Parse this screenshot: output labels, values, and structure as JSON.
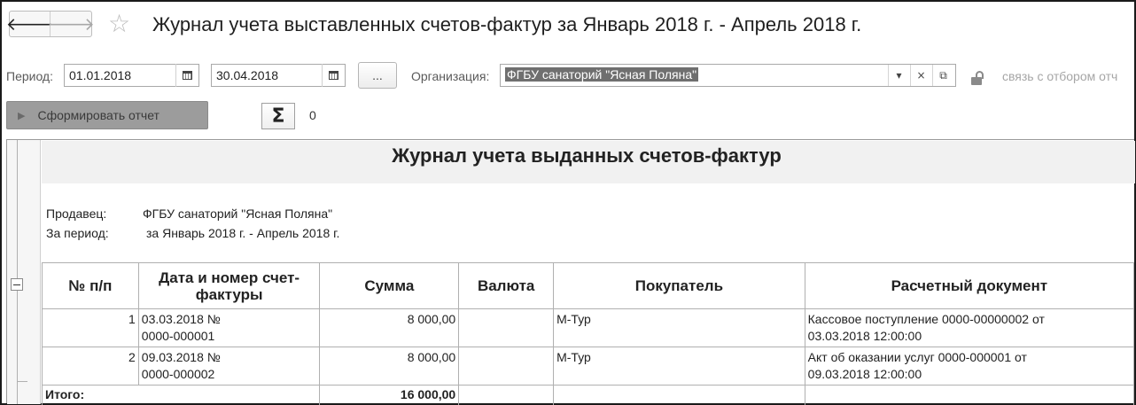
{
  "window": {
    "title": "Журнал учета выставленных счетов-фактур за Январь 2018 г. - Апрель 2018 г.",
    "back_icon": "arrow-left",
    "forward_icon": "arrow-right",
    "favorite_icon": "star"
  },
  "filters": {
    "period_label": "Период:",
    "period_from": "01.01.2018",
    "period_to": "30.04.2018",
    "ellipsis_label": "...",
    "org_label": "Организация:",
    "org_value": "ФГБУ санаторий \"Ясная Поляна\"",
    "org_dropdown": "▾",
    "org_clear": "×",
    "org_open": "⧉",
    "link_label": "связь с отбором отч"
  },
  "actions": {
    "generate_label": "Сформировать отчет",
    "sum_symbol": "Σ",
    "sum_value": "0"
  },
  "report": {
    "title": "Журнал учета выданных счетов-фактур",
    "seller_label": "Продавец:",
    "seller_value": "ФГБУ санаторий \"Ясная Поляна\"",
    "period_label": "За период:",
    "period_value": "за Январь 2018 г. - Апрель 2018 г.",
    "columns": [
      "№ п/п",
      "Дата и номер счет-фактуры",
      "Сумма",
      "Валюта",
      "Покупатель",
      "Расчетный документ"
    ],
    "rows": [
      {
        "n": "1",
        "invoice_line1": "03.03.2018 №",
        "invoice_line2": "0000-000001",
        "amount": "8 000,00",
        "currency": "",
        "buyer": "М-Тур",
        "doc_line1": "Кассовое поступление 0000-00000002 от",
        "doc_line2": "03.03.2018 12:00:00"
      },
      {
        "n": "2",
        "invoice_line1": "09.03.2018 №",
        "invoice_line2": "0000-000002",
        "amount": "8 000,00",
        "currency": "",
        "buyer": "М-Тур",
        "doc_line1": "Акт об оказании услуг 0000-000001 от",
        "doc_line2": "09.03.2018 12:00:00"
      }
    ],
    "total_label": "Итого:",
    "total_amount": "16 000,00"
  }
}
